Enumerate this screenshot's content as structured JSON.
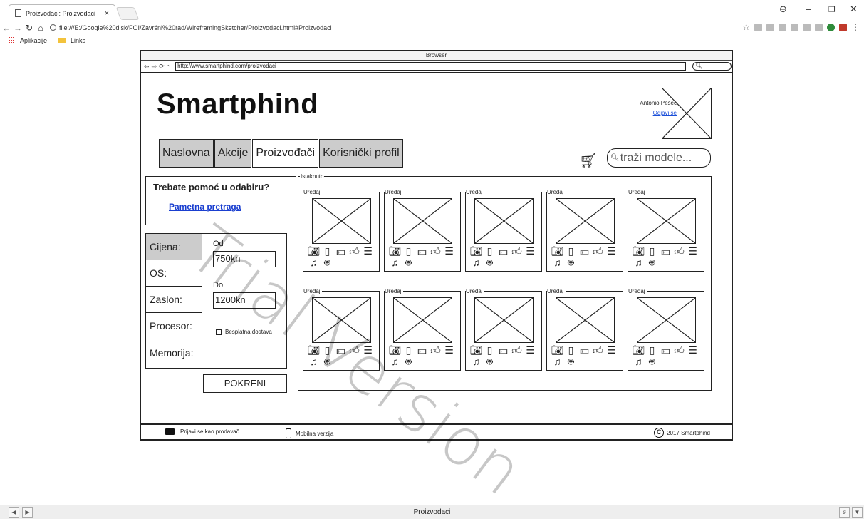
{
  "browser": {
    "tab_title": "Proizvodaci: Proizvodaci",
    "tab_close": "×",
    "url": "file:///E:/Google%20disk/FOI/Završni%20rad/WireframingSketcher/Proizvodaci.html#Proizvodaci",
    "bookmarks": [
      "Aplikacije",
      "Links"
    ],
    "status_text": "Proizvodaci"
  },
  "mockup": {
    "window_title": "Browser",
    "url": "http://www.smartphind.com/proizvodaci",
    "logo": "Smartphind",
    "user_name": "Antonio Pešec",
    "logout": "Odjavi se",
    "nav_tabs": [
      {
        "label": "Naslovna",
        "active": false
      },
      {
        "label": "Akcije",
        "active": false
      },
      {
        "label": "Proizvođači",
        "active": true
      },
      {
        "label": "Korisnički profil",
        "active": false
      }
    ],
    "search_placeholder": "traži modele...",
    "help_title": "Trebate pomoć u odabiru?",
    "help_link": "Pametna pretraga",
    "filter_labels": [
      "Cijena:",
      "OS:",
      "Zaslon:",
      "Procesor:",
      "Memorija:"
    ],
    "from_label": "Od",
    "from_value": "750kn",
    "to_label": "Do",
    "to_value": "1200kn",
    "free_shipping": "Besplatna dostava",
    "run_button": "POKRENI",
    "featured_label": "Istaknuto",
    "card_label": "Uređaj",
    "card_icons": [
      "camera-icon",
      "phone-icon",
      "money-icon",
      "thumbs-up-icon",
      "storage-icon",
      "music-icon",
      "android-icon"
    ],
    "footer": {
      "seller_login": "Prijavi se kao prodavač",
      "mobile": "Mobilna verzija",
      "copyright": "2017 Smartphind"
    },
    "watermark": "Trial Version"
  }
}
